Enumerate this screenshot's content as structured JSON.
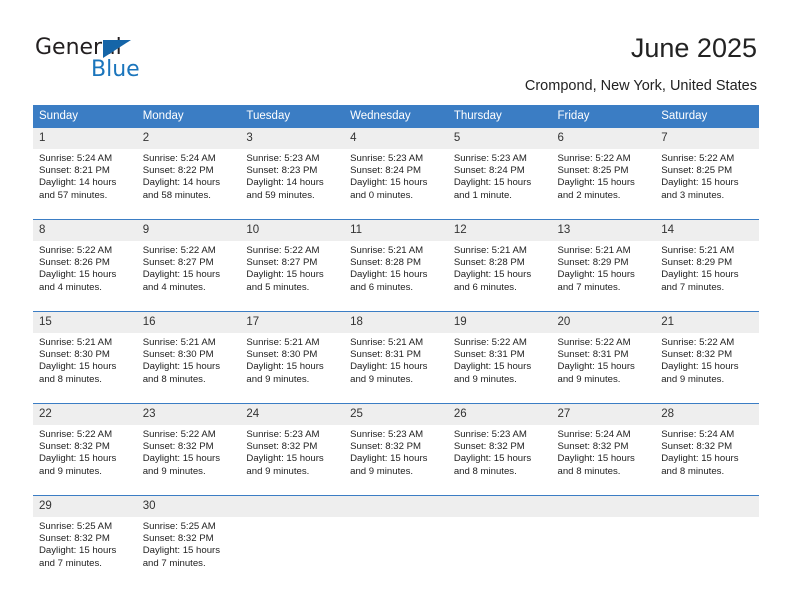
{
  "brand": {
    "name_part1": "General",
    "name_part2": "Blue",
    "triangle_icon": "triangle-icon",
    "accent_color": "#1b75bc"
  },
  "header": {
    "title": "June 2025",
    "subtitle": "Crompond, New York, United States"
  },
  "calendar": {
    "header_bg": "#3b7dc4",
    "daynum_bg": "#eeeeee",
    "weekdays": [
      "Sunday",
      "Monday",
      "Tuesday",
      "Wednesday",
      "Thursday",
      "Friday",
      "Saturday"
    ],
    "weeks": [
      [
        {
          "day": "1",
          "sunrise": "Sunrise: 5:24 AM",
          "sunset": "Sunset: 8:21 PM",
          "daylight_1": "Daylight: 14 hours",
          "daylight_2": "and 57 minutes."
        },
        {
          "day": "2",
          "sunrise": "Sunrise: 5:24 AM",
          "sunset": "Sunset: 8:22 PM",
          "daylight_1": "Daylight: 14 hours",
          "daylight_2": "and 58 minutes."
        },
        {
          "day": "3",
          "sunrise": "Sunrise: 5:23 AM",
          "sunset": "Sunset: 8:23 PM",
          "daylight_1": "Daylight: 14 hours",
          "daylight_2": "and 59 minutes."
        },
        {
          "day": "4",
          "sunrise": "Sunrise: 5:23 AM",
          "sunset": "Sunset: 8:24 PM",
          "daylight_1": "Daylight: 15 hours",
          "daylight_2": "and 0 minutes."
        },
        {
          "day": "5",
          "sunrise": "Sunrise: 5:23 AM",
          "sunset": "Sunset: 8:24 PM",
          "daylight_1": "Daylight: 15 hours",
          "daylight_2": "and 1 minute."
        },
        {
          "day": "6",
          "sunrise": "Sunrise: 5:22 AM",
          "sunset": "Sunset: 8:25 PM",
          "daylight_1": "Daylight: 15 hours",
          "daylight_2": "and 2 minutes."
        },
        {
          "day": "7",
          "sunrise": "Sunrise: 5:22 AM",
          "sunset": "Sunset: 8:25 PM",
          "daylight_1": "Daylight: 15 hours",
          "daylight_2": "and 3 minutes."
        }
      ],
      [
        {
          "day": "8",
          "sunrise": "Sunrise: 5:22 AM",
          "sunset": "Sunset: 8:26 PM",
          "daylight_1": "Daylight: 15 hours",
          "daylight_2": "and 4 minutes."
        },
        {
          "day": "9",
          "sunrise": "Sunrise: 5:22 AM",
          "sunset": "Sunset: 8:27 PM",
          "daylight_1": "Daylight: 15 hours",
          "daylight_2": "and 4 minutes."
        },
        {
          "day": "10",
          "sunrise": "Sunrise: 5:22 AM",
          "sunset": "Sunset: 8:27 PM",
          "daylight_1": "Daylight: 15 hours",
          "daylight_2": "and 5 minutes."
        },
        {
          "day": "11",
          "sunrise": "Sunrise: 5:21 AM",
          "sunset": "Sunset: 8:28 PM",
          "daylight_1": "Daylight: 15 hours",
          "daylight_2": "and 6 minutes."
        },
        {
          "day": "12",
          "sunrise": "Sunrise: 5:21 AM",
          "sunset": "Sunset: 8:28 PM",
          "daylight_1": "Daylight: 15 hours",
          "daylight_2": "and 6 minutes."
        },
        {
          "day": "13",
          "sunrise": "Sunrise: 5:21 AM",
          "sunset": "Sunset: 8:29 PM",
          "daylight_1": "Daylight: 15 hours",
          "daylight_2": "and 7 minutes."
        },
        {
          "day": "14",
          "sunrise": "Sunrise: 5:21 AM",
          "sunset": "Sunset: 8:29 PM",
          "daylight_1": "Daylight: 15 hours",
          "daylight_2": "and 7 minutes."
        }
      ],
      [
        {
          "day": "15",
          "sunrise": "Sunrise: 5:21 AM",
          "sunset": "Sunset: 8:30 PM",
          "daylight_1": "Daylight: 15 hours",
          "daylight_2": "and 8 minutes."
        },
        {
          "day": "16",
          "sunrise": "Sunrise: 5:21 AM",
          "sunset": "Sunset: 8:30 PM",
          "daylight_1": "Daylight: 15 hours",
          "daylight_2": "and 8 minutes."
        },
        {
          "day": "17",
          "sunrise": "Sunrise: 5:21 AM",
          "sunset": "Sunset: 8:30 PM",
          "daylight_1": "Daylight: 15 hours",
          "daylight_2": "and 9 minutes."
        },
        {
          "day": "18",
          "sunrise": "Sunrise: 5:21 AM",
          "sunset": "Sunset: 8:31 PM",
          "daylight_1": "Daylight: 15 hours",
          "daylight_2": "and 9 minutes."
        },
        {
          "day": "19",
          "sunrise": "Sunrise: 5:22 AM",
          "sunset": "Sunset: 8:31 PM",
          "daylight_1": "Daylight: 15 hours",
          "daylight_2": "and 9 minutes."
        },
        {
          "day": "20",
          "sunrise": "Sunrise: 5:22 AM",
          "sunset": "Sunset: 8:31 PM",
          "daylight_1": "Daylight: 15 hours",
          "daylight_2": "and 9 minutes."
        },
        {
          "day": "21",
          "sunrise": "Sunrise: 5:22 AM",
          "sunset": "Sunset: 8:32 PM",
          "daylight_1": "Daylight: 15 hours",
          "daylight_2": "and 9 minutes."
        }
      ],
      [
        {
          "day": "22",
          "sunrise": "Sunrise: 5:22 AM",
          "sunset": "Sunset: 8:32 PM",
          "daylight_1": "Daylight: 15 hours",
          "daylight_2": "and 9 minutes."
        },
        {
          "day": "23",
          "sunrise": "Sunrise: 5:22 AM",
          "sunset": "Sunset: 8:32 PM",
          "daylight_1": "Daylight: 15 hours",
          "daylight_2": "and 9 minutes."
        },
        {
          "day": "24",
          "sunrise": "Sunrise: 5:23 AM",
          "sunset": "Sunset: 8:32 PM",
          "daylight_1": "Daylight: 15 hours",
          "daylight_2": "and 9 minutes."
        },
        {
          "day": "25",
          "sunrise": "Sunrise: 5:23 AM",
          "sunset": "Sunset: 8:32 PM",
          "daylight_1": "Daylight: 15 hours",
          "daylight_2": "and 9 minutes."
        },
        {
          "day": "26",
          "sunrise": "Sunrise: 5:23 AM",
          "sunset": "Sunset: 8:32 PM",
          "daylight_1": "Daylight: 15 hours",
          "daylight_2": "and 8 minutes."
        },
        {
          "day": "27",
          "sunrise": "Sunrise: 5:24 AM",
          "sunset": "Sunset: 8:32 PM",
          "daylight_1": "Daylight: 15 hours",
          "daylight_2": "and 8 minutes."
        },
        {
          "day": "28",
          "sunrise": "Sunrise: 5:24 AM",
          "sunset": "Sunset: 8:32 PM",
          "daylight_1": "Daylight: 15 hours",
          "daylight_2": "and 8 minutes."
        }
      ],
      [
        {
          "day": "29",
          "sunrise": "Sunrise: 5:25 AM",
          "sunset": "Sunset: 8:32 PM",
          "daylight_1": "Daylight: 15 hours",
          "daylight_2": "and 7 minutes."
        },
        {
          "day": "30",
          "sunrise": "Sunrise: 5:25 AM",
          "sunset": "Sunset: 8:32 PM",
          "daylight_1": "Daylight: 15 hours",
          "daylight_2": "and 7 minutes."
        },
        {
          "day": "",
          "sunrise": "",
          "sunset": "",
          "daylight_1": "",
          "daylight_2": ""
        },
        {
          "day": "",
          "sunrise": "",
          "sunset": "",
          "daylight_1": "",
          "daylight_2": ""
        },
        {
          "day": "",
          "sunrise": "",
          "sunset": "",
          "daylight_1": "",
          "daylight_2": ""
        },
        {
          "day": "",
          "sunrise": "",
          "sunset": "",
          "daylight_1": "",
          "daylight_2": ""
        },
        {
          "day": "",
          "sunrise": "",
          "sunset": "",
          "daylight_1": "",
          "daylight_2": ""
        }
      ]
    ]
  }
}
